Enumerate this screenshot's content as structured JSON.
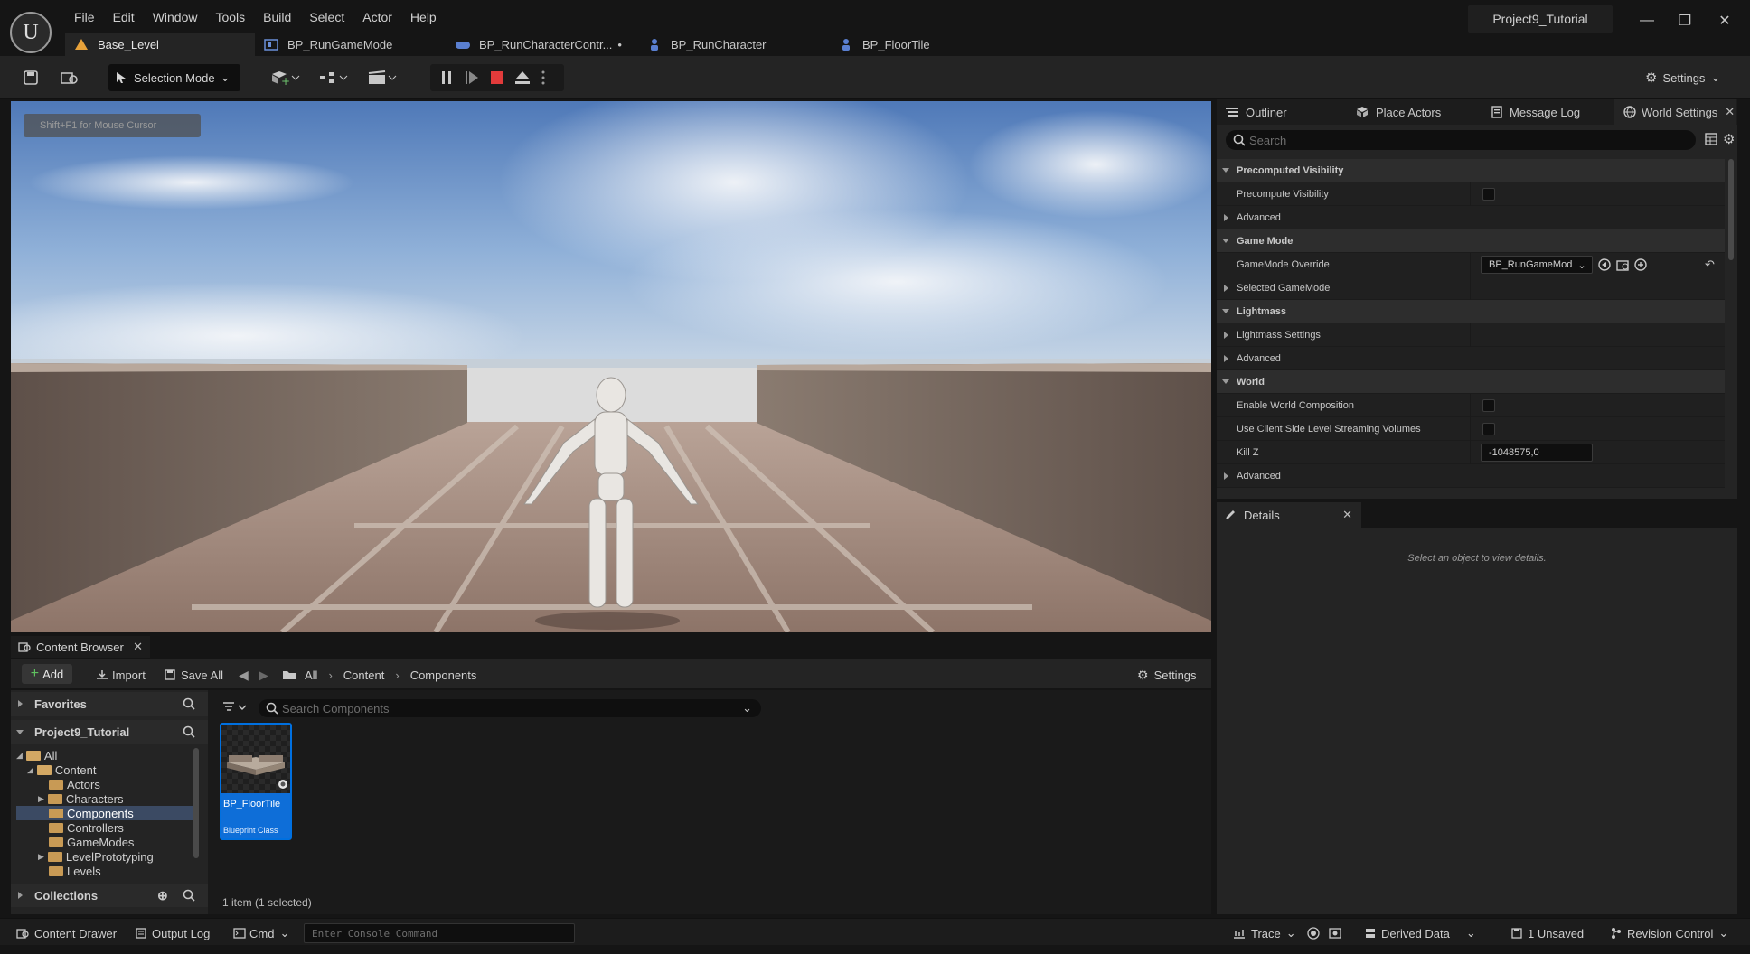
{
  "app": {
    "project_name": "Project9_Tutorial",
    "menu": [
      "File",
      "Edit",
      "Window",
      "Tools",
      "Build",
      "Select",
      "Actor",
      "Help"
    ],
    "doc_tabs": [
      {
        "label": "Base_Level",
        "icon": "level-icon"
      },
      {
        "label": "BP_RunGameMode",
        "icon": "blueprint-icon"
      },
      {
        "label": "BP_RunCharacterContr...",
        "icon": "controller-blueprint-icon",
        "modified": "•"
      },
      {
        "label": "BP_RunCharacter",
        "icon": "character-blueprint-icon"
      },
      {
        "label": "BP_FloorTile",
        "icon": "actor-blueprint-icon"
      }
    ]
  },
  "toolbar": {
    "selection_mode": "Selection Mode",
    "settings": "Settings"
  },
  "viewport": {
    "hint": "Shift+F1 for Mouse Cursor"
  },
  "panels": {
    "tabs": [
      "Outliner",
      "Place Actors",
      "Message Log",
      "World Settings"
    ],
    "active_tab": "World Settings",
    "search_placeholder": "Search"
  },
  "world_settings": {
    "precomputed_visibility": "Precomputed Visibility",
    "precompute_visibility": "Precompute Visibility",
    "advanced": "Advanced",
    "game_mode": "Game Mode",
    "gamemode_override": "GameMode Override",
    "gamemode_value": "BP_RunGameMod",
    "selected_gamemode": "Selected GameMode",
    "lightmass": "Lightmass",
    "lightmass_settings": "Lightmass Settings",
    "world": "World",
    "enable_world_composition": "Enable World Composition",
    "client_streaming": "Use Client Side Level Streaming Volumes",
    "kill_z": "Kill Z",
    "kill_z_value": "-1048575,0"
  },
  "details": {
    "title": "Details",
    "empty_message": "Select an object to view details."
  },
  "content_browser": {
    "title": "Content Browser",
    "add": "Add",
    "import": "Import",
    "save_all": "Save All",
    "breadcrumb": [
      "All",
      "Content",
      "Components"
    ],
    "settings": "Settings",
    "favorites": "Favorites",
    "project": "Project9_Tutorial",
    "tree": [
      "All",
      "Content",
      "Actors",
      "Characters",
      "Components",
      "Controllers",
      "GameModes",
      "LevelPrototyping",
      "Levels"
    ],
    "collections": "Collections",
    "search_placeholder": "Search Components",
    "asset": {
      "name": "BP_FloorTile",
      "type": "Blueprint Class"
    },
    "status": "1 item (1 selected)"
  },
  "statusbar": {
    "content_drawer": "Content Drawer",
    "output_log": "Output Log",
    "cmd": "Cmd",
    "console_placeholder": "Enter Console Command",
    "trace": "Trace",
    "derived_data": "Derived Data",
    "unsaved": "1 Unsaved",
    "revision_control": "Revision Control"
  }
}
